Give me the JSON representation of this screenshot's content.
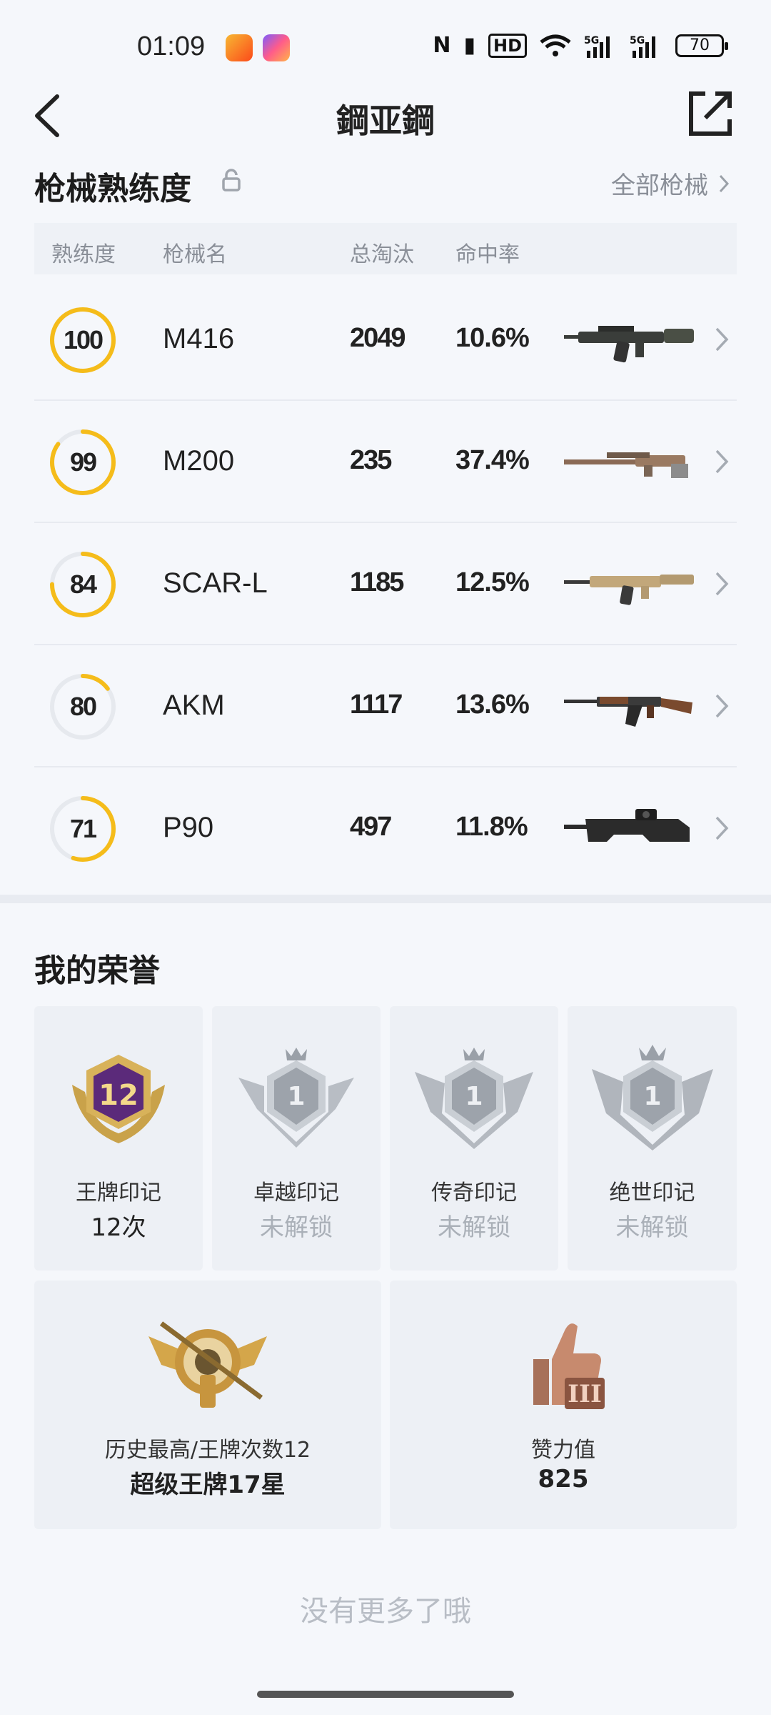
{
  "status_bar": {
    "time": "01:09",
    "indicators": [
      "nfc-icon",
      "vibrate-icon",
      "hd-icon",
      "wifi-icon",
      "5g-signal-icon",
      "5g-signal-icon"
    ],
    "battery": "70"
  },
  "header": {
    "title": "鋼亚鋼"
  },
  "weapon_section": {
    "title": "枪械熟练度",
    "all_link": "全部枪械",
    "columns": {
      "proficiency": "熟练度",
      "name": "枪械名",
      "kills": "总淘汰",
      "accuracy": "命中率"
    },
    "ring_color": "#f5bc1a",
    "rows": [
      {
        "level": "100",
        "progress": 1.0,
        "name": "M416",
        "kills": "2049",
        "accuracy": "10.6%"
      },
      {
        "level": "99",
        "progress": 0.85,
        "name": "M200",
        "kills": "235",
        "accuracy": "37.4%"
      },
      {
        "level": "84",
        "progress": 0.75,
        "name": "SCAR-L",
        "kills": "1185",
        "accuracy": "12.5%"
      },
      {
        "level": "80",
        "progress": 0.15,
        "name": "AKM",
        "kills": "1117",
        "accuracy": "13.6%"
      },
      {
        "level": "71",
        "progress": 0.55,
        "name": "P90",
        "kills": "497",
        "accuracy": "11.8%"
      }
    ]
  },
  "honor_section": {
    "title": "我的荣誉",
    "badges": [
      {
        "label": "王牌印记",
        "value": "12次",
        "badge_number": "12",
        "locked": false
      },
      {
        "label": "卓越印记",
        "value": "未解锁",
        "badge_number": "1",
        "locked": true
      },
      {
        "label": "传奇印记",
        "value": "未解锁",
        "badge_number": "1",
        "locked": true
      },
      {
        "label": "绝世印记",
        "value": "未解锁",
        "badge_number": "1",
        "locked": true
      }
    ],
    "stats": [
      {
        "label": "历史最高/王牌次数12",
        "value": "超级王牌17星"
      },
      {
        "label": "赞力值",
        "value": "825"
      }
    ]
  },
  "footer": {
    "no_more": "没有更多了哦"
  }
}
